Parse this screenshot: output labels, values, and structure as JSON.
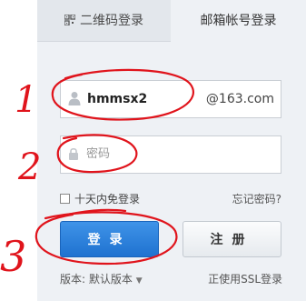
{
  "tabs": {
    "qr_label": "二维码登录",
    "mail_label": "邮箱帐号登录"
  },
  "login_form": {
    "username_value": "hmmsx2",
    "domain_suffix": "@163.com",
    "password_placeholder": "密码",
    "remember_label": "十天内免登录",
    "forgot_label": "忘记密码?",
    "login_button_label": "登录",
    "register_button_label": "注册",
    "version_label": "版本: 默认版本",
    "ssl_label": "正使用SSL登录"
  },
  "annotations": {
    "label_1": "1",
    "label_2": "2",
    "label_3": "3"
  },
  "colors": {
    "annotation": "#e0141c",
    "primary_button": "#2a7fdc",
    "panel": "#eef1f5"
  }
}
